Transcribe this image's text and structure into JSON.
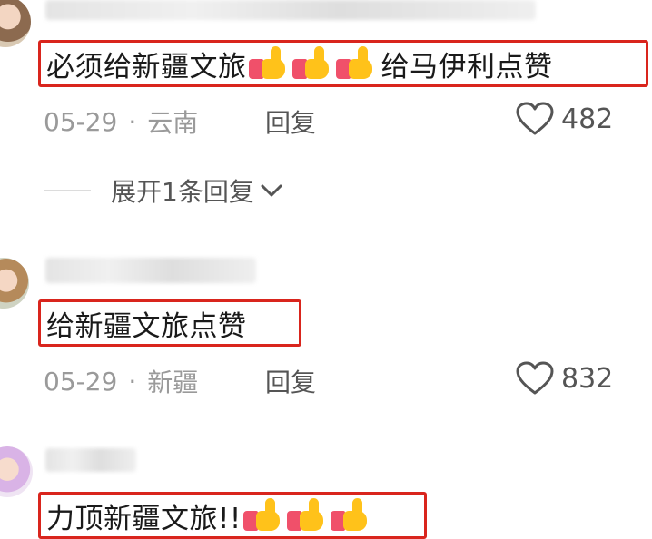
{
  "comments": [
    {
      "text_before": "必须给新疆文旅",
      "emoji_count": 3,
      "text_after": "给马伊利点赞",
      "date": "05-29",
      "separator": "·",
      "location": "云南",
      "reply_label": "回复",
      "likes": "482",
      "expand_label": "展开1条回复"
    },
    {
      "text_before": "给新疆文旅点赞",
      "emoji_count": 0,
      "text_after": "",
      "date": "05-29",
      "separator": "·",
      "location": "新疆",
      "reply_label": "回复",
      "likes": "832"
    },
    {
      "text_before": "力顶新疆文旅!!",
      "emoji_count": 3,
      "text_after": ""
    }
  ],
  "icons": {
    "like": "heart-outline-icon",
    "expand": "chevron-down-icon",
    "emoji": "thumbs-up-emoji"
  },
  "colors": {
    "highlight_border": "#d9251d",
    "meta_text": "#9a9a9a",
    "action_text": "#555555"
  }
}
